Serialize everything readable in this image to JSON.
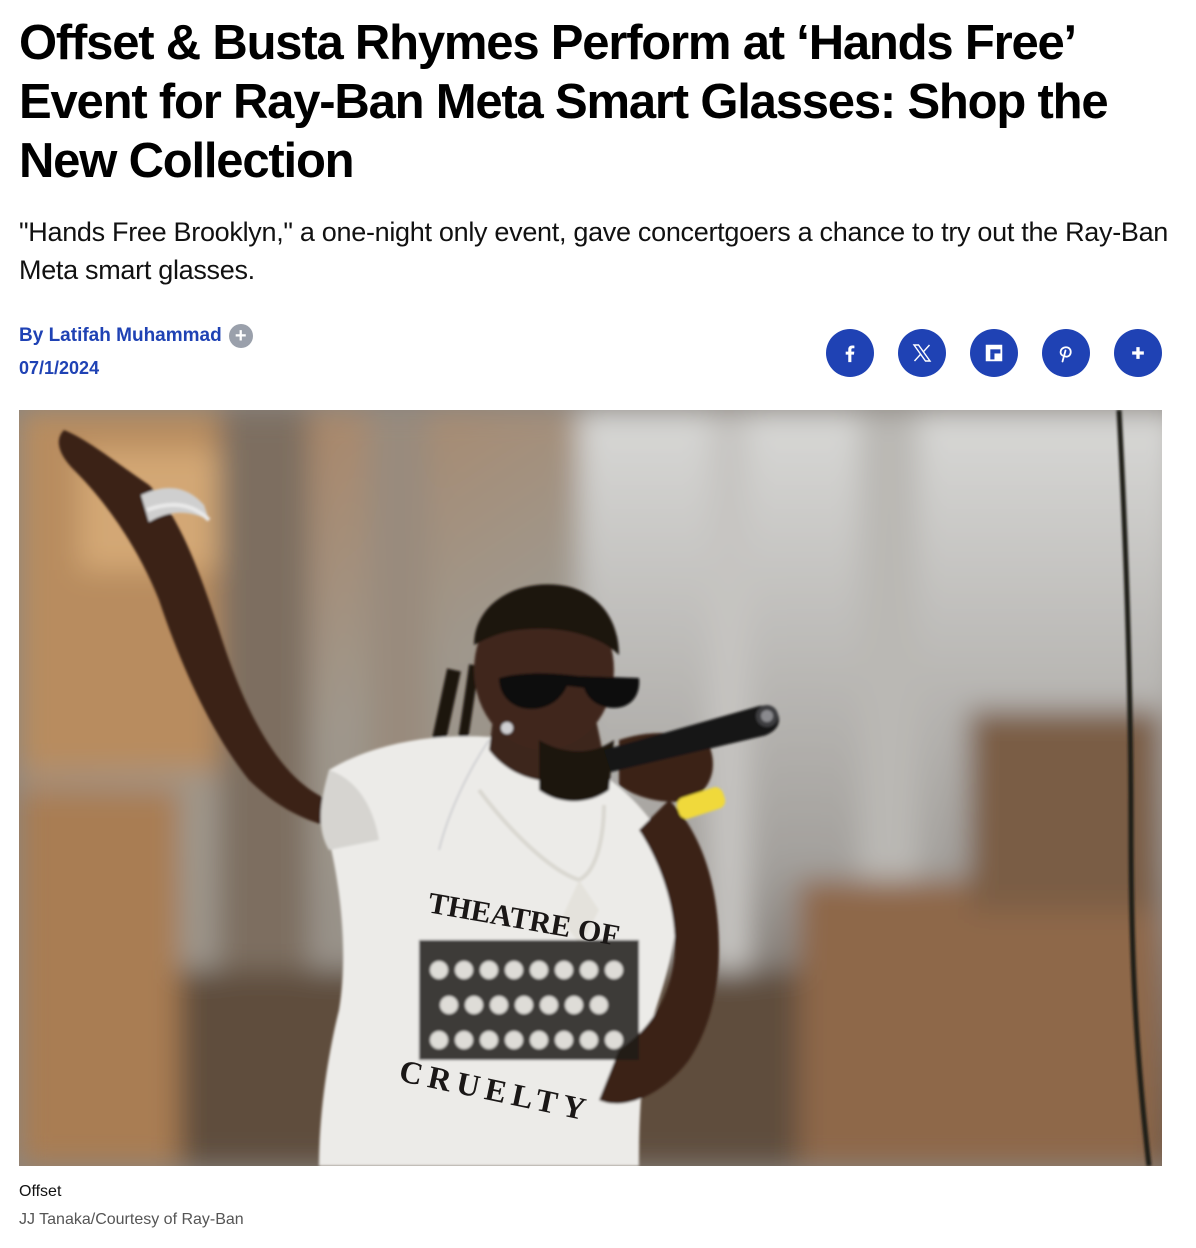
{
  "article": {
    "headline": "Offset & Busta Rhymes Perform at ‘Hands Free’ Event for Ray-Ban Meta Smart Glasses: Shop the New Collection",
    "dek": "\"Hands Free Brooklyn,\" a one-night only event, gave concertgoers a chance to try out the Ray-Ban Meta smart glasses.",
    "byline_prefix": "By",
    "author": "Latifah Muhammad",
    "follow_icon": "plus-icon",
    "date": "07/1/2024"
  },
  "share": {
    "accent_color": "#1f42b4",
    "buttons": [
      {
        "icon": "facebook-icon"
      },
      {
        "icon": "x-icon"
      },
      {
        "icon": "flipboard-icon"
      },
      {
        "icon": "pinterest-icon"
      },
      {
        "icon": "plus-icon"
      }
    ]
  },
  "hero_image": {
    "shirt_text_top": "THEATRE OF",
    "shirt_text_bottom": "CRUELTY",
    "caption": "Offset",
    "credit": "JJ Tanaka/Courtesy of Ray-Ban"
  }
}
